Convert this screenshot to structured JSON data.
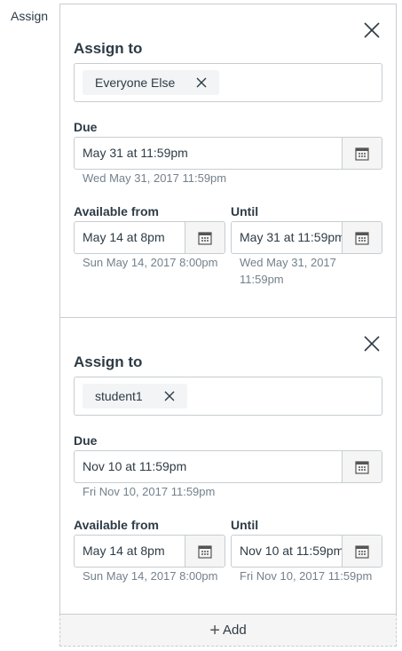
{
  "side_label": "Assign",
  "cards": [
    {
      "assign_to_label": "Assign to",
      "token": "Everyone Else",
      "due_label": "Due",
      "due_value": "May 31 at 11:59pm",
      "due_hint": "Wed May 31, 2017 11:59pm",
      "available_label": "Available from",
      "available_value": "May 14 at 8pm",
      "available_hint": "Sun May 14, 2017 8:00pm",
      "until_label": "Until",
      "until_value": "May 31 at 11:59pm",
      "until_hint_line1": "Wed May 31, 2017",
      "until_hint_line2": "11:59pm"
    },
    {
      "assign_to_label": "Assign to",
      "token": "student1",
      "due_label": "Due",
      "due_value": "Nov 10 at 11:59pm",
      "due_hint": "Fri Nov 10, 2017 11:59pm",
      "available_label": "Available from",
      "available_value": "May 14 at 8pm",
      "available_hint": "Sun May 14, 2017 8:00pm",
      "until_label": "Until",
      "until_value": "Nov 10 at 11:59pm",
      "until_hint": "Fri Nov 10, 2017 11:59pm"
    }
  ],
  "add_label": "Add",
  "add_icon": "plus-icon",
  "colors": {
    "text": "#2d3b45",
    "hint": "#73818c",
    "border": "#c7cdd1",
    "token_bg": "#f2f4f5"
  }
}
